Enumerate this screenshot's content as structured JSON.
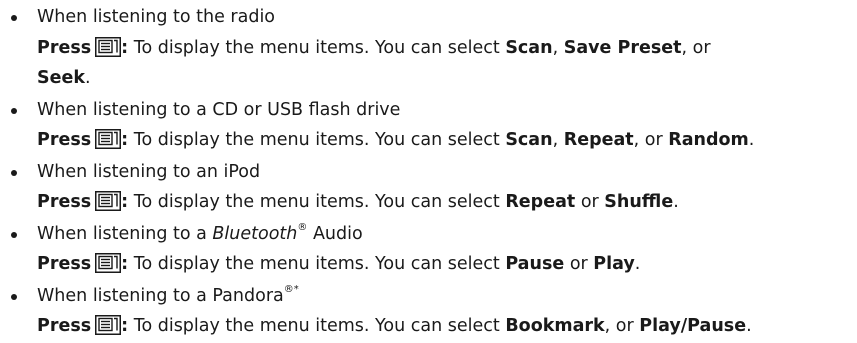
{
  "items": [
    {
      "condition_pre": "When listening to the radio",
      "press": "Press",
      "colon": ":",
      "text_a": " To display the menu items. You can select ",
      "opt1": "Scan",
      "sep1": ", ",
      "opt2": "Save Preset",
      "sep2": ", or",
      "opt3": "Seek",
      "end": "."
    },
    {
      "condition_pre": "When listening to a CD or USB flash drive",
      "press": "Press",
      "colon": ":",
      "text_a": " To display the menu items. You can select ",
      "opt1": "Scan",
      "sep1": ", ",
      "opt2": "Repeat",
      "sep2": ", or ",
      "opt3": "Random",
      "end": "."
    },
    {
      "condition_pre": "When listening to an iPod",
      "press": "Press",
      "colon": ":",
      "text_a": " To display the menu items. You can select ",
      "opt1": "Repeat",
      "sep1": " or ",
      "opt2": "Shuffle",
      "end": "."
    },
    {
      "condition_pre": "When listening to a ",
      "condition_italic": "Bluetooth",
      "condition_reg": "®",
      "condition_post": " Audio",
      "press": "Press",
      "colon": ":",
      "text_a": " To display the menu items. You can select ",
      "opt1": "Pause",
      "sep1": " or ",
      "opt2": "Play",
      "end": "."
    },
    {
      "condition_pre": "When listening to a Pandora",
      "condition_reg": "®",
      "condition_star": "*",
      "press": "Press",
      "colon": ":",
      "text_a": " To display the menu items. You can select ",
      "opt1": "Bookmark",
      "sep1": ", or ",
      "opt2": "Play/Pause",
      "end": "."
    }
  ],
  "icons": {
    "menu_button": "menu-button-icon"
  },
  "colors": {
    "text": "#1a1a1a",
    "background": "#ffffff"
  }
}
